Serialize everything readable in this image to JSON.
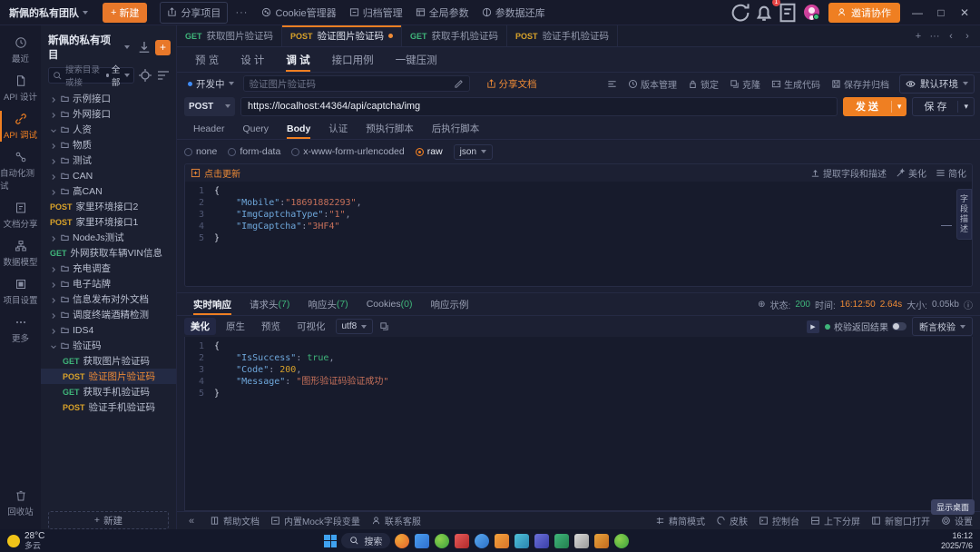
{
  "titlebar": {
    "team": "斯佩的私有团队",
    "new_button": "新建",
    "share_project": "分享项目",
    "more_dots": "···",
    "cookie_manager": "Cookie管理器",
    "archive_manager": "归档管理",
    "global_params": "全局参数",
    "param_lib": "参数据还库",
    "notification_count": "1",
    "invite": "邀请协作",
    "minimize": "—",
    "maximize": "□",
    "close": "✕"
  },
  "rail": {
    "items": [
      {
        "label": "最近",
        "icon": "clock-icon",
        "active": false
      },
      {
        "label": "API 设计",
        "icon": "document-icon",
        "active": false
      },
      {
        "label": "API 调试",
        "icon": "link-icon",
        "active": true
      },
      {
        "label": "自动化测试",
        "icon": "flow-icon",
        "active": false
      },
      {
        "label": "文档分享",
        "icon": "share-doc-icon",
        "active": false
      },
      {
        "label": "数据模型",
        "icon": "model-icon",
        "active": false
      },
      {
        "label": "项目设置",
        "icon": "settings-icon",
        "active": false
      },
      {
        "label": "更多",
        "icon": "ellipsis-icon",
        "active": false
      }
    ],
    "recycle": "回收站"
  },
  "tree": {
    "title": "斯佩的私有项目",
    "search_placeholder": "搜索目录或接",
    "filter_label": "全部",
    "add_button": "+",
    "new_button": "新建",
    "nodes": [
      {
        "type": "folder",
        "label": "示例接口",
        "expanded": false,
        "indent": 1
      },
      {
        "type": "folder",
        "label": "外网接口",
        "expanded": false,
        "indent": 1
      },
      {
        "type": "folder",
        "label": "人资",
        "expanded": true,
        "indent": 1
      },
      {
        "type": "folder",
        "label": "物质",
        "expanded": false,
        "indent": 1
      },
      {
        "type": "folder",
        "label": "测试",
        "expanded": false,
        "indent": 1
      },
      {
        "type": "folder",
        "label": "CAN",
        "expanded": false,
        "indent": 1
      },
      {
        "type": "folder",
        "label": "高CAN",
        "expanded": false,
        "indent": 1
      },
      {
        "type": "api",
        "method": "POST",
        "label": "家里环境接口2",
        "indent": 1
      },
      {
        "type": "api",
        "method": "POST",
        "label": "家里环境接口1",
        "indent": 1
      },
      {
        "type": "folder",
        "label": "NodeJs测试",
        "expanded": false,
        "indent": 1
      },
      {
        "type": "api",
        "method": "GET",
        "label": "外网获取车辆VIN信息",
        "indent": 1
      },
      {
        "type": "folder",
        "label": "充电调查",
        "expanded": false,
        "indent": 1
      },
      {
        "type": "folder",
        "label": "电子站牌",
        "expanded": false,
        "indent": 1
      },
      {
        "type": "folder",
        "label": "信息发布对外文档",
        "expanded": false,
        "indent": 1
      },
      {
        "type": "folder",
        "label": "调度终端酒精检测",
        "expanded": false,
        "indent": 1
      },
      {
        "type": "folder",
        "label": "IDS4",
        "expanded": false,
        "indent": 1
      },
      {
        "type": "folder",
        "label": "验证码",
        "expanded": true,
        "indent": 1
      },
      {
        "type": "api",
        "method": "GET",
        "label": "获取图片验证码",
        "indent": 2
      },
      {
        "type": "api",
        "method": "POST",
        "label": "验证图片验证码",
        "indent": 2,
        "selected": true
      },
      {
        "type": "api",
        "method": "GET",
        "label": "获取手机验证码",
        "indent": 2
      },
      {
        "type": "api",
        "method": "POST",
        "label": "验证手机验证码",
        "indent": 2
      }
    ]
  },
  "file_tabs": [
    {
      "method": "GET",
      "label": "获取图片验证码",
      "active": false,
      "dirty": false
    },
    {
      "method": "POST",
      "label": "验证图片验证码",
      "active": true,
      "dirty": true
    },
    {
      "method": "GET",
      "label": "获取手机验证码",
      "active": false,
      "dirty": false
    },
    {
      "method": "POST",
      "label": "验证手机验证码",
      "active": false,
      "dirty": false
    }
  ],
  "sub_tabs": [
    {
      "label": "预 览",
      "active": false
    },
    {
      "label": "设 计",
      "active": false
    },
    {
      "label": "调 试",
      "active": true
    },
    {
      "label": "接口用例",
      "active": false
    },
    {
      "label": "一键压测",
      "active": false
    }
  ],
  "meta": {
    "status": "开发中",
    "name_placeholder": "验证图片验证码",
    "share_doc": "分享文档",
    "version_manage": "版本管理",
    "lock": "锁定",
    "clone": "克隆",
    "generate_code": "生成代码",
    "save_archive": "保存并归档",
    "environment": "默认环境"
  },
  "request": {
    "method": "POST",
    "url": "https://localhost:44364/api/captcha/img",
    "send": "发 送",
    "save": "保 存"
  },
  "request_tabs": [
    {
      "label": "Header",
      "active": false
    },
    {
      "label": "Query",
      "active": false
    },
    {
      "label": "Body",
      "active": true
    },
    {
      "label": "认证",
      "active": false
    },
    {
      "label": "预执行脚本",
      "active": false
    },
    {
      "label": "后执行脚本",
      "active": false
    }
  ],
  "body_types": [
    {
      "label": "none",
      "selected": false
    },
    {
      "label": "form-data",
      "selected": false
    },
    {
      "label": "x-www-form-urlencoded",
      "selected": false
    },
    {
      "label": "raw",
      "selected": true
    }
  ],
  "body_format": "json",
  "editor": {
    "update_label": "点击更新",
    "extract_label": "提取字段和描述",
    "beautify_label": "美化",
    "simplify_label": "简化",
    "side_panel": "字段描述",
    "lines": [
      "1",
      "2",
      "3",
      "4",
      "5"
    ],
    "json": {
      "mobile_key": "\"Mobile\"",
      "mobile_val": "\"18691882293\"",
      "type_key": "\"ImgCaptchaType\"",
      "type_val": "\"1\"",
      "captcha_key": "\"ImgCaptcha\"",
      "captcha_val": "\"3HF4\""
    }
  },
  "response_tabs": [
    {
      "label": "实时响应",
      "count": "",
      "active": true
    },
    {
      "label": "请求头",
      "count": "(7)",
      "active": false
    },
    {
      "label": "响应头",
      "count": "(7)",
      "active": false
    },
    {
      "label": "Cookies",
      "count": "(0)",
      "active": false
    },
    {
      "label": "响应示例",
      "count": "",
      "active": false
    }
  ],
  "response_meta": {
    "status_label": "状态:",
    "status_value": "200",
    "time_label": "时间:",
    "time_value": "16:12:50",
    "duration": "2.64s",
    "size_label": "大小:",
    "size_value": "0.05kb"
  },
  "response_tools": {
    "beautify": "美化",
    "raw": "原生",
    "preview": "预览",
    "visualize": "可视化",
    "encoding": "utf8",
    "verify_label": "校验返回结果",
    "assert_label": "断言校验"
  },
  "response_body": {
    "lines": [
      "1",
      "2",
      "3",
      "4",
      "5"
    ],
    "issuccess_key": "\"IsSuccess\"",
    "issuccess_val": "true",
    "code_key": "\"Code\"",
    "code_val": "200",
    "message_key": "\"Message\"",
    "message_val": "\"图形验证码验证成功\""
  },
  "footer": {
    "help_doc": "帮助文档",
    "mock_vars": "内置Mock字段变量",
    "contact": "联系客服",
    "simple_mode": "精简模式",
    "skin": "皮肤",
    "console": "控制台",
    "split": "上下分屏",
    "new_window": "新窗口打开",
    "settings": "设置",
    "tooltip": "显示桌面"
  },
  "taskbar": {
    "temperature": "28°C",
    "weather": "多云",
    "search_placeholder": "搜索",
    "time": "16:12",
    "date": "2025/7/6"
  }
}
